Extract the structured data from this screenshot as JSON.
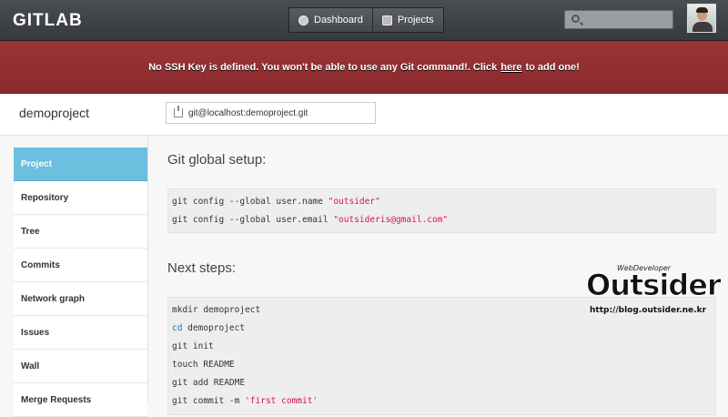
{
  "app": {
    "logo": "GITLAB"
  },
  "nav": {
    "dashboard_label": "Dashboard",
    "projects_label": "Projects"
  },
  "search": {
    "placeholder": ""
  },
  "warning": {
    "before": "No SSH Key is defined. You won't be able to use any Git command!. Click",
    "link": "here",
    "after": "to add one!"
  },
  "project": {
    "name": "demoproject",
    "clone_url": "git@localhost:demoproject.git"
  },
  "sidebar": {
    "items": [
      {
        "label": "Project"
      },
      {
        "label": "Repository"
      },
      {
        "label": "Tree"
      },
      {
        "label": "Commits"
      },
      {
        "label": "Network graph"
      },
      {
        "label": "Issues"
      },
      {
        "label": "Wall"
      },
      {
        "label": "Merge Requests"
      }
    ]
  },
  "main": {
    "global_setup_title": "Git global setup:",
    "global_setup": {
      "line1_cmd": "git config --global user.name ",
      "line1_val": "\"outsider\"",
      "line2_cmd": "git config --global user.email  ",
      "line2_val": "\"outsideris@gmail.com\""
    },
    "next_steps_title": "Next steps:",
    "next_steps": {
      "l1": "mkdir demoproject",
      "l2_kw": "cd",
      "l2_rest": " demoproject",
      "l3": "git init",
      "l4": "touch README",
      "l5": "git add README",
      "l6_cmd": "git commit -m ",
      "l6_val": "'first commit'"
    }
  },
  "watermark": {
    "small": "WebDeveloper",
    "big": "Outsider",
    "url": "http://blog.outsider.ne.kr"
  }
}
